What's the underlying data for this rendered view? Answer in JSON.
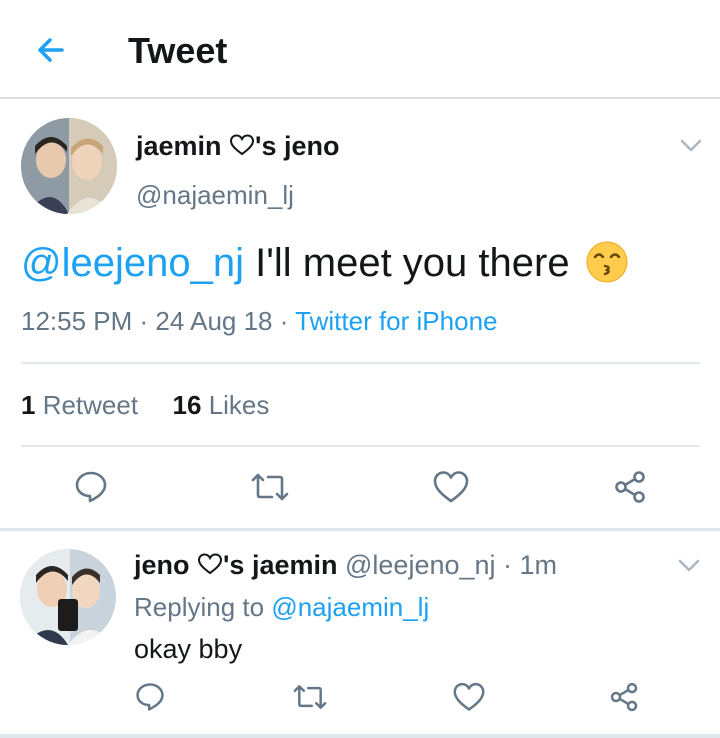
{
  "header": {
    "title": "Tweet",
    "back_icon": "arrow-left-icon",
    "accent": "#1da1f2"
  },
  "tweet": {
    "display_name_pre": "jaemin ",
    "display_name_post": "'s jeno",
    "handle": "@najaemin_lj",
    "mention": "@leejeno_nj",
    "text": " I'll meet you there",
    "emoji_icon": "kissing-face-smiling-eyes-icon",
    "time": "12:55 PM",
    "sep1": " · ",
    "date": "24 Aug 18",
    "sep2": " · ",
    "source": "Twitter for iPhone",
    "retweets_count": "1",
    "retweets_label": " Retweet",
    "likes_count": "16",
    "likes_label": " Likes"
  },
  "reply": {
    "display_name_pre": "jeno ",
    "display_name_post": "'s jaemin",
    "handle_time": " @leejeno_nj · 1m",
    "replying_prefix": "Replying to ",
    "replying_handle": "@najaemin_lj",
    "text": "okay bby"
  },
  "colors": {
    "text": "#14171a",
    "secondary": "#657786",
    "link": "#1da1f2",
    "divider": "#e1e8ed"
  },
  "icons": [
    "reply-icon",
    "retweet-icon",
    "like-heart-icon",
    "share-icon",
    "chevron-down-icon",
    "heart-outline-icon"
  ]
}
